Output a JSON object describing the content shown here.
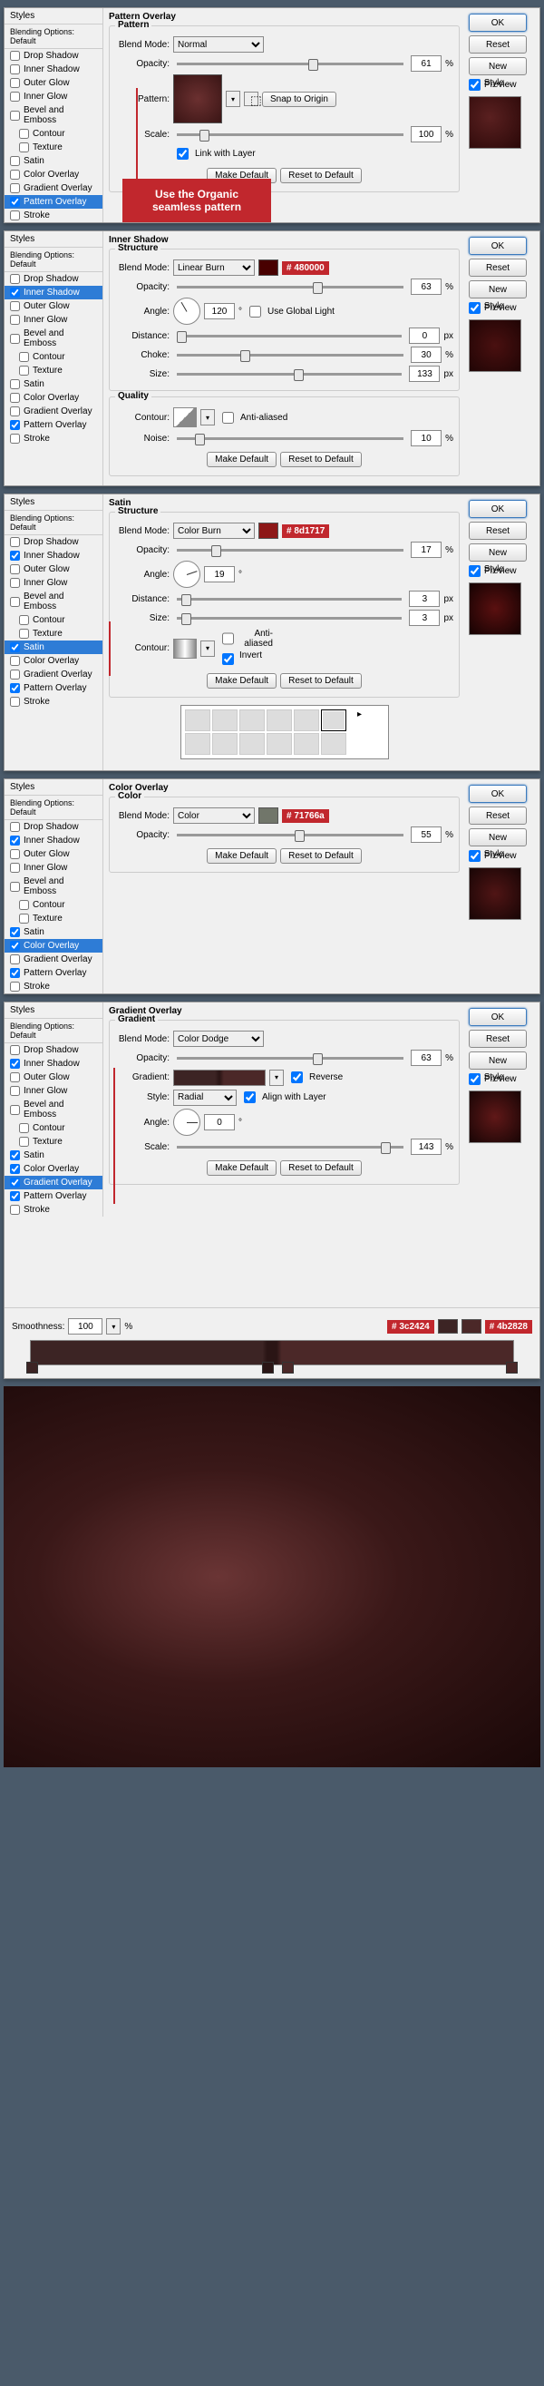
{
  "styles_header": "Styles",
  "blending_default": "Blending Options: Default",
  "items": {
    "drop_shadow": "Drop Shadow",
    "inner_shadow": "Inner Shadow",
    "outer_glow": "Outer Glow",
    "inner_glow": "Inner Glow",
    "bevel_emboss": "Bevel and Emboss",
    "contour": "Contour",
    "texture": "Texture",
    "satin": "Satin",
    "color_overlay": "Color Overlay",
    "gradient_overlay": "Gradient Overlay",
    "pattern_overlay": "Pattern Overlay",
    "stroke": "Stroke"
  },
  "buttons": {
    "ok": "OK",
    "reset": "Reset",
    "new_style": "New Style...",
    "preview": "Preview",
    "make_default": "Make Default",
    "reset_default": "Reset to Default",
    "snap_origin": "Snap to Origin"
  },
  "labels": {
    "blend_mode": "Blend Mode:",
    "opacity": "Opacity:",
    "pattern": "Pattern:",
    "scale": "Scale:",
    "link_layer": "Link with Layer",
    "angle": "Angle:",
    "use_global": "Use Global Light",
    "distance": "Distance:",
    "choke": "Choke:",
    "size": "Size:",
    "noise": "Noise:",
    "anti_aliased": "Anti-aliased",
    "contour": "Contour:",
    "invert": "Invert",
    "gradient": "Gradient:",
    "reverse": "Reverse",
    "style": "Style:",
    "align_layer": "Align with Layer",
    "smoothness": "Smoothness:",
    "pct": "%",
    "px": "px",
    "deg": "°"
  },
  "panel1": {
    "title": "Pattern Overlay",
    "group": "Pattern",
    "blend_mode": "Normal",
    "opacity": "61",
    "scale": "100",
    "callout": "Use the Organic seamless pattern"
  },
  "panel2": {
    "title": "Inner Shadow",
    "group1": "Structure",
    "group2": "Quality",
    "blend_mode": "Linear Burn",
    "color_tag": "# 480000",
    "color_hex": "#480000",
    "opacity": "63",
    "angle": "120",
    "distance": "0",
    "choke": "30",
    "size": "133",
    "noise": "10"
  },
  "panel3": {
    "title": "Satin",
    "group": "Structure",
    "blend_mode": "Color Burn",
    "color_tag": "# 8d1717",
    "color_hex": "#8d1717",
    "opacity": "17",
    "angle": "19",
    "distance": "3",
    "size": "3"
  },
  "panel4": {
    "title": "Color Overlay",
    "group": "Color",
    "blend_mode": "Color",
    "color_tag": "# 71766a",
    "color_hex": "#71766a",
    "opacity": "55"
  },
  "panel5": {
    "title": "Gradient Overlay",
    "group": "Gradient",
    "blend_mode": "Color Dodge",
    "opacity": "63",
    "style": "Radial",
    "angle": "0",
    "scale": "143",
    "smoothness": "100",
    "color_tag1": "# 3c2424",
    "color_tag2": "# 4b2828"
  }
}
